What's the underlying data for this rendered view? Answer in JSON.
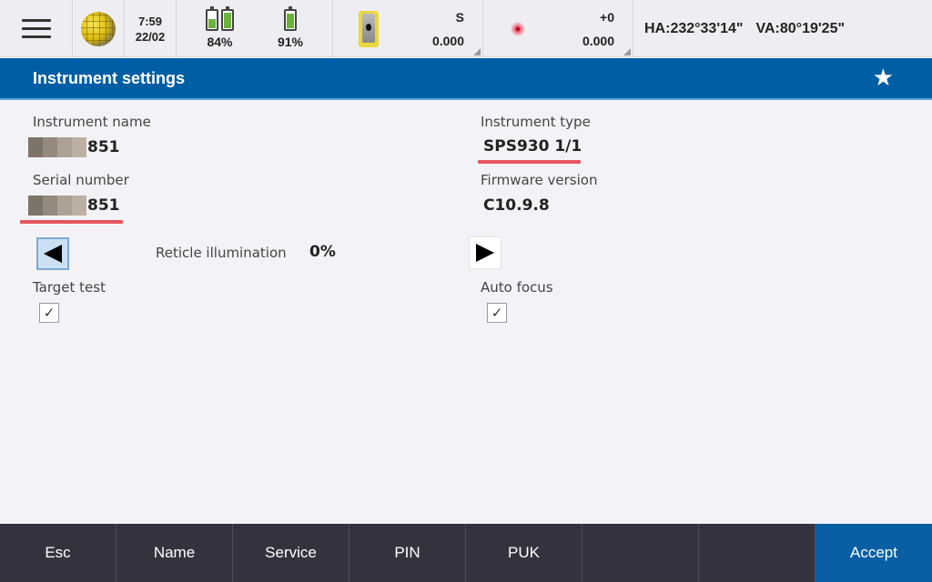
{
  "status_bar": {
    "menu_icon": "hamburger-menu-icon",
    "gnss_icon": "globe-icon",
    "time": "7:59",
    "date": "22/02",
    "controller_battery": {
      "icon": "dual-battery-icon",
      "percent_label": "84%",
      "levels": [
        0.55,
        0.95
      ]
    },
    "instrument_battery": {
      "icon": "battery-icon",
      "percent_label": "91%",
      "level": 0.91
    },
    "instrument": {
      "icon": "total-station-icon",
      "mode": "S",
      "value": "0.000"
    },
    "target": {
      "icon": "laser-target-icon",
      "offset": "+0",
      "value": "0.000"
    },
    "angles": {
      "ha": "HA:232°33'14\"",
      "va": "VA:80°19'25\""
    }
  },
  "title_bar": {
    "title": "Instrument settings",
    "favorite_icon": "star-icon"
  },
  "form": {
    "instrument_name": {
      "label": "Instrument name",
      "value_suffix": "851",
      "redacted": true
    },
    "serial_number": {
      "label": "Serial number",
      "value_suffix": "851",
      "redacted": true
    },
    "instrument_type": {
      "label": "Instrument type",
      "value": "SPS930 1/1"
    },
    "firmware_version": {
      "label": "Firmware version",
      "value": "C10.9.8"
    },
    "reticle_illumination": {
      "label": "Reticle illumination",
      "value": "0%"
    },
    "target_test": {
      "label": "Target test",
      "checked": true,
      "check_glyph": "✓"
    },
    "auto_focus": {
      "label": "Auto focus",
      "checked": true,
      "check_glyph": "✓"
    }
  },
  "annotation_color": "#e8555f",
  "softkeys": [
    {
      "label": "Esc"
    },
    {
      "label": "Name"
    },
    {
      "label": "Service"
    },
    {
      "label": "PIN"
    },
    {
      "label": "PUK"
    },
    {
      "label": ""
    },
    {
      "label": ""
    },
    {
      "label": "Accept"
    }
  ],
  "colors": {
    "title_bar": "#005ea4",
    "softkey_bar": "#35323f",
    "accept": "#0a5fa4",
    "battery_fill": "#6ab23b"
  }
}
